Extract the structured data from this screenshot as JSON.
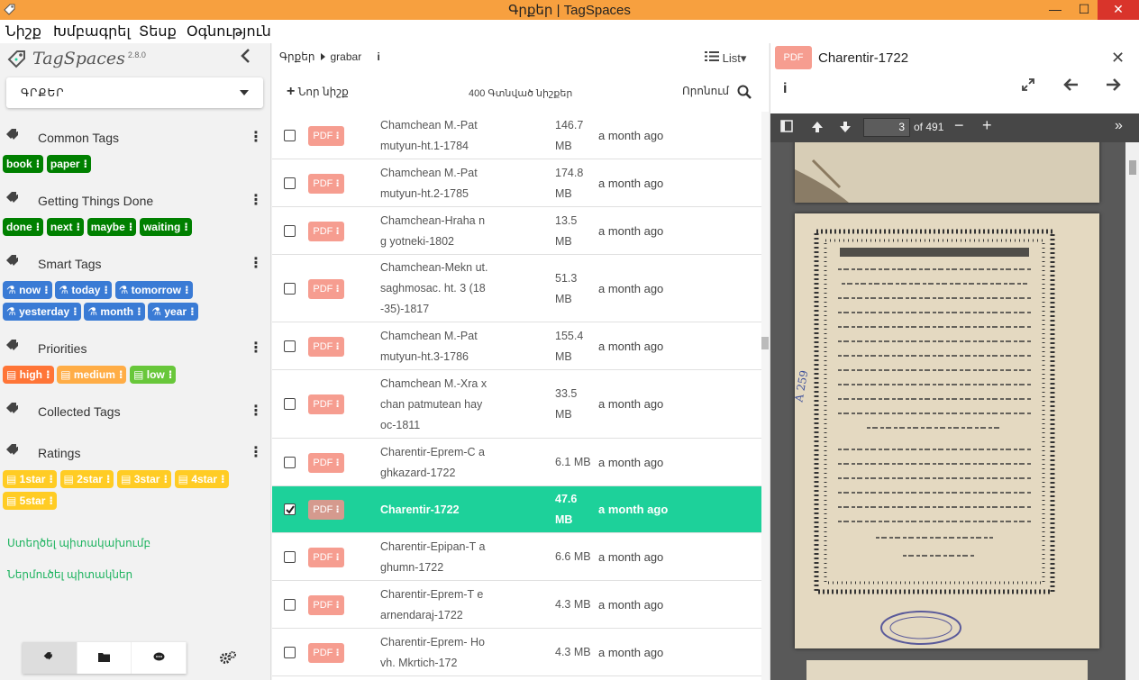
{
  "window": {
    "title": "Գրքեր | TagSpaces",
    "minimize": "—",
    "maximize": "☐",
    "close": "✕"
  },
  "menu": [
    "Նիշք",
    "Խմբագրել",
    "Տեսք",
    "Օգնություն"
  ],
  "sidebar": {
    "logo": "TagSpaces",
    "version": "2.8.0",
    "location": "ԳՐՔԵՐ",
    "groups": [
      {
        "name": "Common Tags",
        "tags": [
          {
            "label": "book",
            "color": "#008000"
          },
          {
            "label": "paper",
            "color": "#008000"
          }
        ]
      },
      {
        "name": "Getting Things Done",
        "tags": [
          {
            "label": "done",
            "color": "#008000"
          },
          {
            "label": "next",
            "color": "#008000"
          },
          {
            "label": "maybe",
            "color": "#008000"
          },
          {
            "label": "waiting",
            "color": "#008000"
          }
        ]
      },
      {
        "name": "Smart Tags",
        "tags": [
          {
            "label": "now"
          },
          {
            "label": "today"
          },
          {
            "label": "tomorrow"
          },
          {
            "label": "yesterday"
          },
          {
            "label": "month"
          },
          {
            "label": "year"
          }
        ]
      },
      {
        "name": "Priorities",
        "tags": [
          {
            "label": "high"
          },
          {
            "label": "medium"
          },
          {
            "label": "low"
          }
        ]
      },
      {
        "name": "Collected Tags",
        "tags": []
      },
      {
        "name": "Ratings",
        "tags": [
          {
            "label": "1star"
          },
          {
            "label": "2star"
          },
          {
            "label": "3star"
          },
          {
            "label": "4star"
          },
          {
            "label": "5star"
          }
        ]
      }
    ],
    "links": {
      "create_group": "Ստեղծել պիտակախումբ",
      "import_tags": "Ներմուծել պիտակներ"
    }
  },
  "filelist": {
    "breadcrumb": {
      "root": "Գրքեր",
      "folder": "grabar"
    },
    "view_mode": "List",
    "new_file": "Նոր նիշք",
    "count_text": "400 Գտնված նիշքեր",
    "search_label": "Որոնում",
    "file_type": "PDF",
    "files": [
      {
        "name": "Chamchean M.-Pat mutyun-ht.1-1784",
        "size": "146.7 MB",
        "date": "a month ago",
        "checked": false
      },
      {
        "name": "Chamchean M.-Pat mutyun-ht.2-1785",
        "size": "174.8 MB",
        "date": "a month ago",
        "checked": false
      },
      {
        "name": "Chamchean-Hraha ng yotneki-1802",
        "size": "13.5 MB",
        "date": "a month ago",
        "checked": false
      },
      {
        "name": "Chamchean-Mekn ut. saghmosac. ht. 3 (18-35)-1817",
        "size": "51.3 MB",
        "date": "a month ago",
        "checked": false
      },
      {
        "name": "Chamchean M.-Pat mutyun-ht.3-1786",
        "size": "155.4 MB",
        "date": "a month ago",
        "checked": false
      },
      {
        "name": "Chamchean M.-Xra xchan patmutean hayoc-1811",
        "size": "33.5 MB",
        "date": "a month ago",
        "checked": false
      },
      {
        "name": "Charentir-Eprem-C aghkazard-1722",
        "size": "6.1 MB",
        "date": "a month ago",
        "checked": false
      },
      {
        "name": "Charentir-1722",
        "size": "47.6 MB",
        "date": "a month ago",
        "checked": true
      },
      {
        "name": "Charentir-Epipan-T aghumn-1722",
        "size": "6.6 MB",
        "date": "a month ago",
        "checked": false
      },
      {
        "name": "Charentir-Eprem-T earnendaraj-1722",
        "size": "4.3 MB",
        "date": "a month ago",
        "checked": false
      },
      {
        "name": "Charentir-Eprem- Hovh. Mkrtich-172",
        "size": "4.3 MB",
        "date": "a month ago",
        "checked": false
      }
    ]
  },
  "preview": {
    "file_type": "PDF",
    "title": "Charentir-1722",
    "current_page": "3",
    "total_pages": "of 491"
  }
}
